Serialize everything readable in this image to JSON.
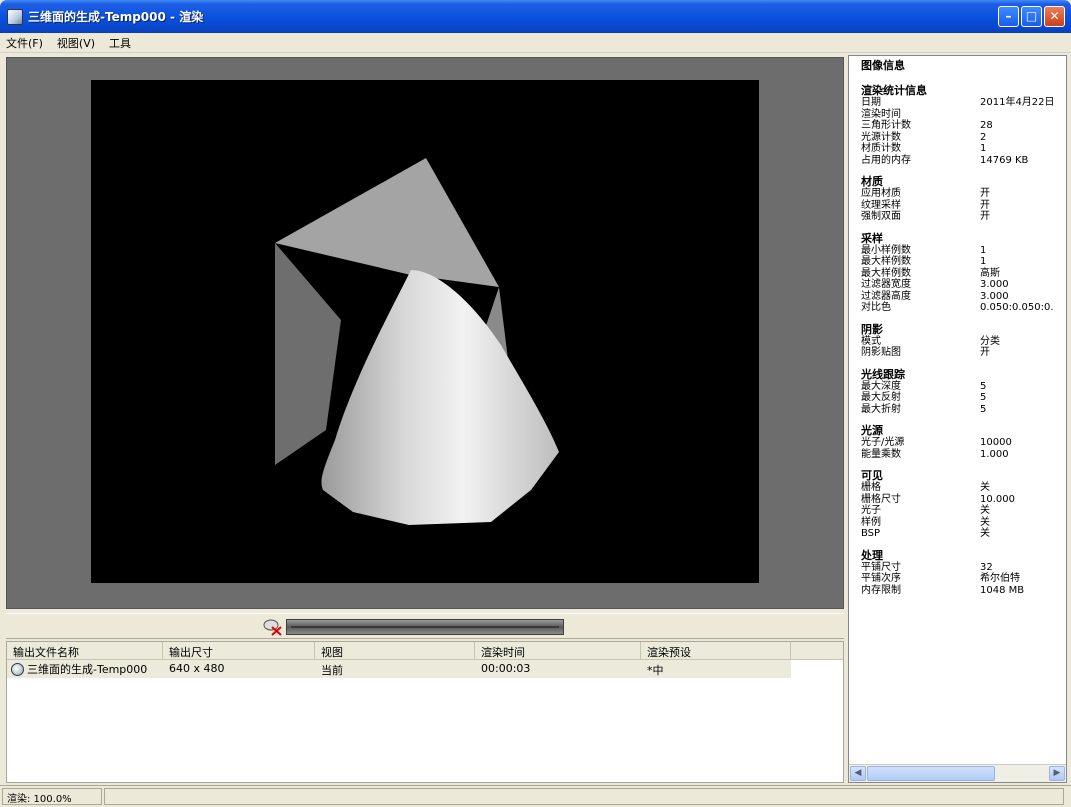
{
  "window": {
    "title": "三维面的生成-Temp000 - 渲染"
  },
  "menu": [
    "文件(F)",
    "视图(V)",
    "工具"
  ],
  "progress": {
    "fraction": 1.0
  },
  "output_list": {
    "headers": [
      "输出文件名称",
      "输出尺寸",
      "视图",
      "渲染时间",
      "渲染预设"
    ],
    "rows": [
      {
        "name": "三维面的生成-Temp000",
        "size": "640 x 480",
        "view": "当前",
        "time": "00:00:03",
        "preset": "*中"
      }
    ]
  },
  "info": {
    "title": "图像信息",
    "sections": [
      {
        "title": "渲染统计信息",
        "rows": [
          [
            "日期",
            "2011年4月22日"
          ],
          [
            "渲染时间",
            ""
          ],
          [
            "三角形计数",
            "28"
          ],
          [
            "光源计数",
            "2"
          ],
          [
            "材质计数",
            "1"
          ],
          [
            "占用的内存",
            "14769 KB"
          ]
        ]
      },
      {
        "title": "材质",
        "rows": [
          [
            "应用材质",
            "开"
          ],
          [
            "纹理采样",
            "开"
          ],
          [
            "强制双面",
            "开"
          ]
        ]
      },
      {
        "title": "采样",
        "rows": [
          [
            "最小样例数",
            "1"
          ],
          [
            "最大样例数",
            "1"
          ],
          [
            "最大样例数",
            "高斯"
          ],
          [
            "过滤器宽度",
            "3.000"
          ],
          [
            "过滤器高度",
            "3.000"
          ],
          [
            "对比色",
            "0.050:0.050:0."
          ]
        ]
      },
      {
        "title": "阴影",
        "rows": [
          [
            "模式",
            "分类"
          ],
          [
            "阴影贴图",
            "开"
          ]
        ]
      },
      {
        "title": "光线跟踪",
        "rows": [
          [
            "最大深度",
            "5"
          ],
          [
            "最大反射",
            "5"
          ],
          [
            "最大折射",
            "5"
          ]
        ]
      },
      {
        "title": "光源",
        "rows": [
          [
            "光子/光源",
            "10000"
          ],
          [
            "能量乘数",
            "1.000"
          ]
        ]
      },
      {
        "title": "可见",
        "rows": [
          [
            "栅格",
            "关"
          ],
          [
            "栅格尺寸",
            "10.000"
          ],
          [
            "光子",
            "关"
          ],
          [
            "样例",
            "关"
          ],
          [
            "BSP",
            "关"
          ]
        ]
      },
      {
        "title": "处理",
        "rows": [
          [
            "平铺尺寸",
            "32"
          ],
          [
            "平铺次序",
            "希尔伯特"
          ],
          [
            "内存限制",
            "1048 MB"
          ]
        ]
      }
    ]
  },
  "status": {
    "text": "渲染: 100.0%"
  }
}
